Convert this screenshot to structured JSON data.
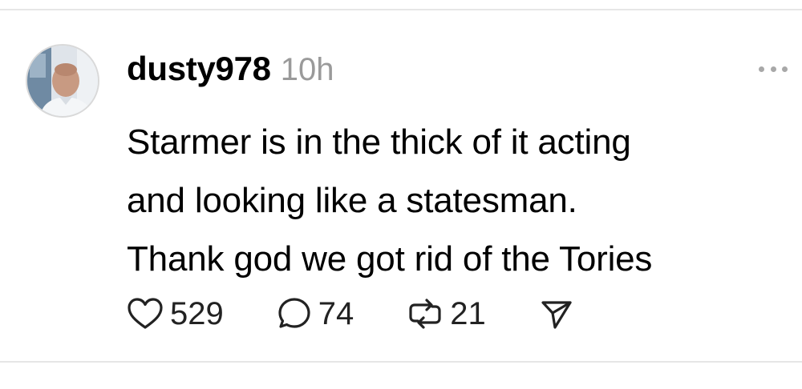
{
  "post": {
    "author": {
      "username": "dusty978",
      "avatar_alt": "profile photo"
    },
    "time": "10h",
    "text_lines": [
      "Starmer is in the thick of it acting",
      "and looking like a statesman.",
      "Thank god we got rid of the Tories"
    ],
    "stats": {
      "likes": "529",
      "replies": "74",
      "reposts": "21"
    }
  },
  "icons": {
    "more": "more-horizontal-icon",
    "like": "heart-icon",
    "reply": "speech-bubble-icon",
    "repost": "repost-icon",
    "share": "paper-plane-icon"
  },
  "colors": {
    "text": "#000000",
    "muted": "#9a9a9a",
    "divider": "#e6e6e6",
    "icon": "#222222"
  }
}
